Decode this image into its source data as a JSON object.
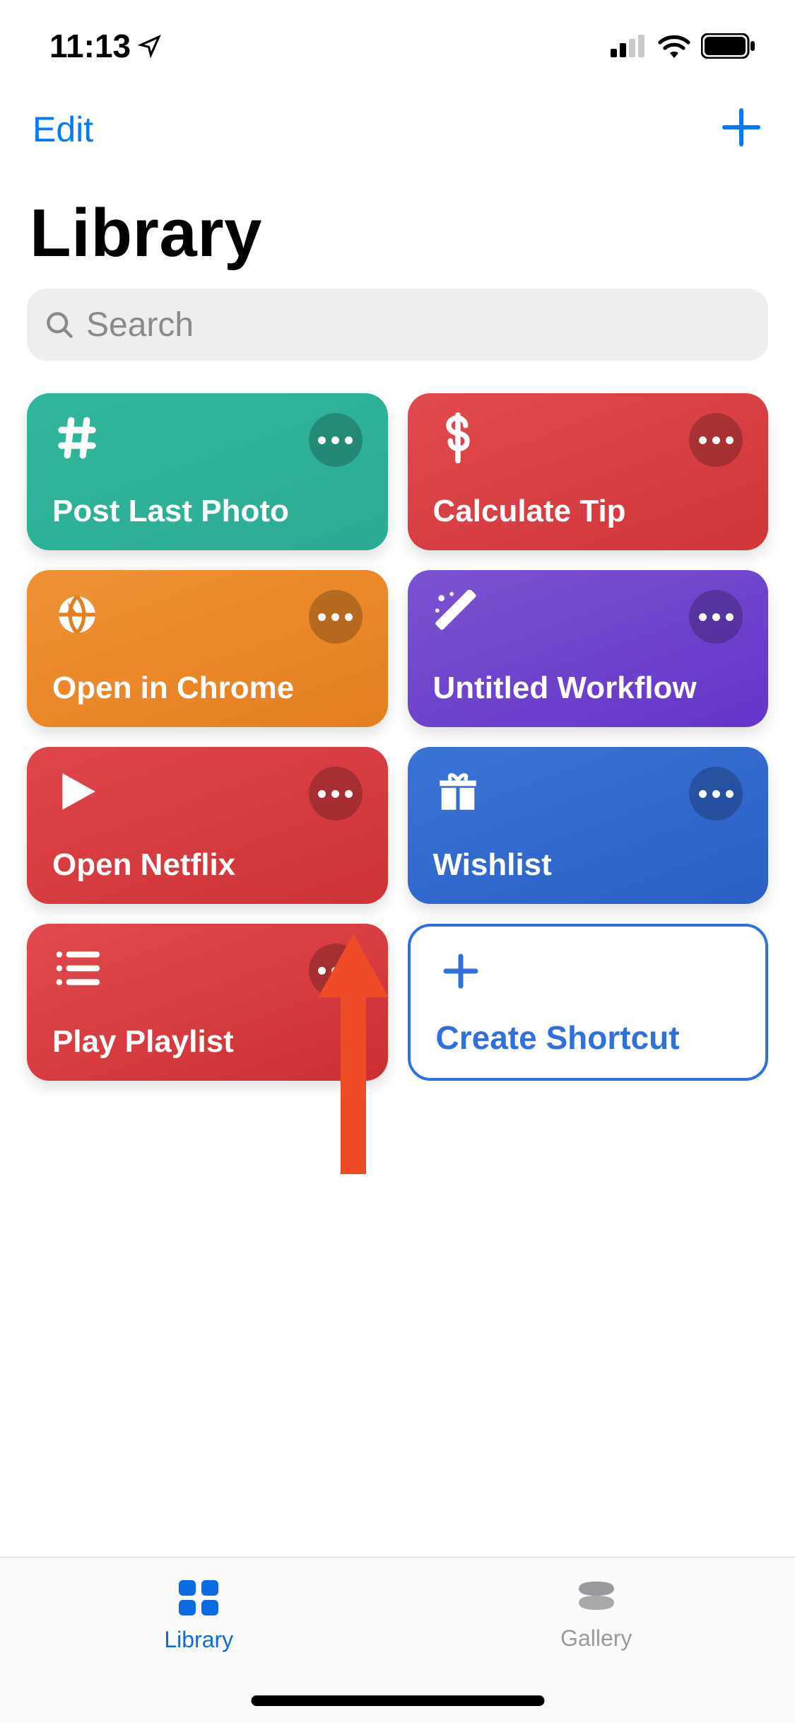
{
  "status": {
    "time": "11:13"
  },
  "nav": {
    "edit": "Edit"
  },
  "title": "Library",
  "search": {
    "placeholder": "Search"
  },
  "tiles": [
    {
      "label": "Post Last Photo",
      "icon": "hash-icon",
      "bg": "teal"
    },
    {
      "label": "Calculate Tip",
      "icon": "dollar-icon",
      "bg": "red"
    },
    {
      "label": "Open in Chrome",
      "icon": "globe-icon",
      "bg": "orange"
    },
    {
      "label": "Untitled Workflow",
      "icon": "wand-icon",
      "bg": "purple"
    },
    {
      "label": "Open Netflix",
      "icon": "play-icon",
      "bg": "red2"
    },
    {
      "label": "Wishlist",
      "icon": "gift-icon",
      "bg": "blue"
    },
    {
      "label": "Play Playlist",
      "icon": "list-icon",
      "bg": "red3"
    }
  ],
  "create_label": "Create Shortcut",
  "tabs": {
    "library": "Library",
    "gallery": "Gallery"
  }
}
